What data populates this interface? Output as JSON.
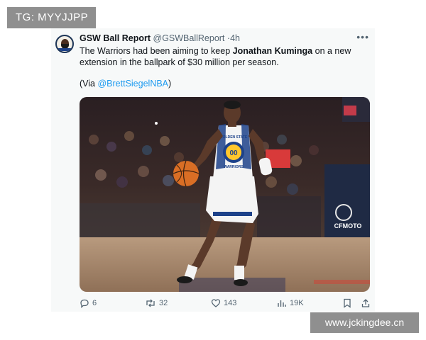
{
  "watermark_top": "TG: MYYJJPP",
  "watermark_bottom": "www.jckingdee.cn",
  "tweet": {
    "display_name": "GSW Ball Report",
    "handle": "@GSWBallReport",
    "separator": "·",
    "time": "4h",
    "text_before": "The Warriors had been aiming to keep ",
    "text_bold": "Jonathan Kuminga",
    "text_after": " on a new extension in the ballpark of $30 million per season.",
    "via_prefix": "(Via ",
    "via_mention": "@BrettSiegelNBA",
    "via_suffix": ")",
    "avatar_icon": "gsw-ball-report-avatar",
    "media": {
      "jersey_text": "GOLDEN STATE",
      "jersey_number": "00",
      "jersey_bottom": "WARRIORS",
      "arena_text": "CFMOTO"
    }
  },
  "actions": {
    "replies": "6",
    "retweets": "32",
    "likes": "143",
    "views": "19K"
  },
  "colors": {
    "link": "#1d9bf0",
    "text": "#0f1419",
    "muted": "#536471",
    "warriors_blue": "#1d428a",
    "warriors_gold": "#ffc72c"
  }
}
